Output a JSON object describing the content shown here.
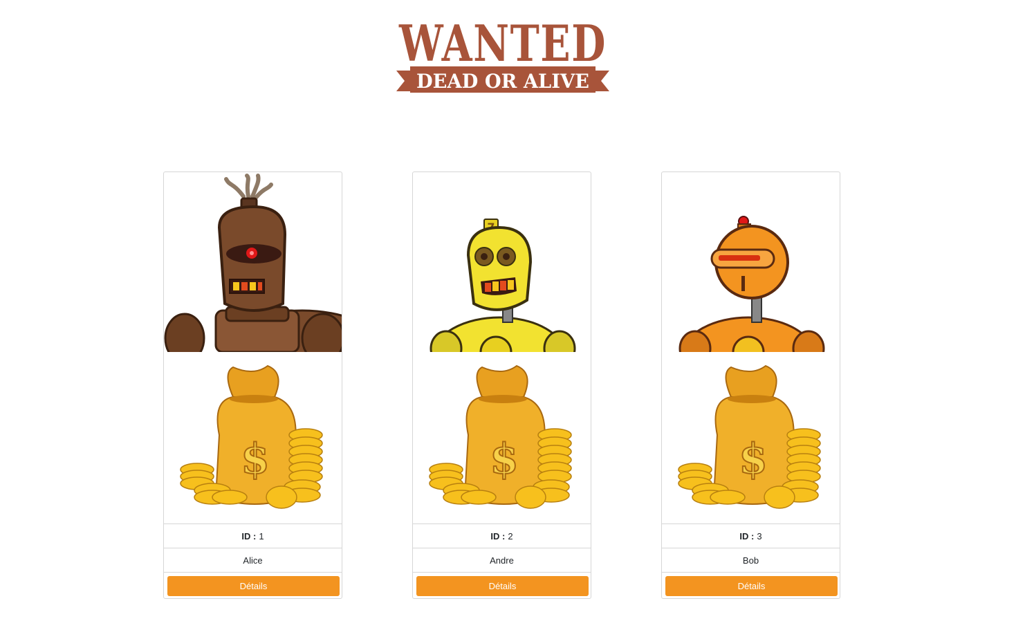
{
  "header": {
    "logo_title": "WANTED",
    "logo_subtitle": "DEAD OR ALIVE",
    "colors": {
      "logo": "#a8543a"
    }
  },
  "id_label": "ID :",
  "details_label": "Détails",
  "accent": "#f39420",
  "cards": [
    {
      "id": "1",
      "name": "Alice",
      "robot_icon": "brown-robot-icon",
      "robot_color": "#7a4a2b"
    },
    {
      "id": "2",
      "name": "Andre",
      "robot_icon": "yellow-robot-icon",
      "robot_color": "#f2e230"
    },
    {
      "id": "3",
      "name": "Bob",
      "robot_icon": "orange-robot-icon",
      "robot_color": "#f39420"
    }
  ]
}
